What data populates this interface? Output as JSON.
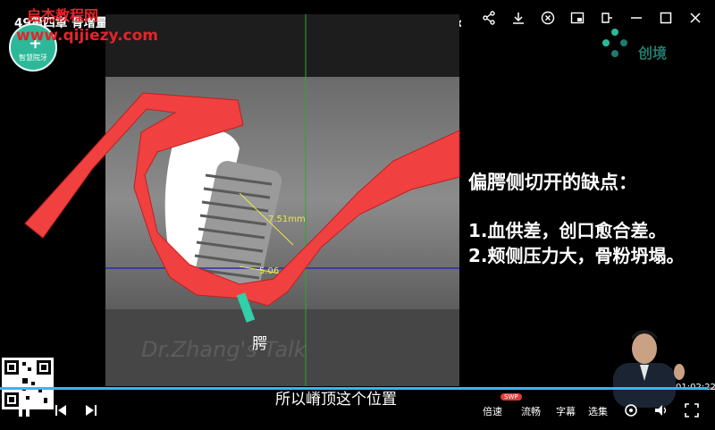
{
  "window": {
    "title": "49第四章 骨增量与软组织移植【第十一节课】.骨增量操作细节(教程网www.jiaochengs.co...",
    "icons": [
      "share-icon",
      "download-icon",
      "close-circle-icon",
      "pip-icon",
      "pin-icon",
      "minimize-icon",
      "maximize-icon",
      "close-icon"
    ]
  },
  "watermark": {
    "site_name": "启杰教程网",
    "site_url": "www.qijiezy.com",
    "logo_text": "智慧院牙"
  },
  "brand": {
    "name": "创境"
  },
  "slide": {
    "heading": "偏腭侧切开的缺点：",
    "points": [
      "1.血供差，创口愈合差。",
      "2.颊侧压力大，骨粉坍塌。"
    ],
    "measure_1": "7.51mm",
    "measure_2": "5.06",
    "cheek_label": "腭",
    "watermark": "Dr.Zhang's Talk"
  },
  "subtitle": "所以嵴顶这个位置",
  "player": {
    "time": "01:02:22",
    "progress_pct": 0.99,
    "speed_label": "倍速",
    "speed_badge": "SWP",
    "quality_label": "流畅",
    "caption_label": "字幕",
    "episodes_label": "选集",
    "qr_label": ""
  },
  "colors": {
    "accent": "#39b3ff",
    "flap_red": "#f04040",
    "watermark_red": "#e5242a",
    "brand_teal": "#2eb89a"
  }
}
